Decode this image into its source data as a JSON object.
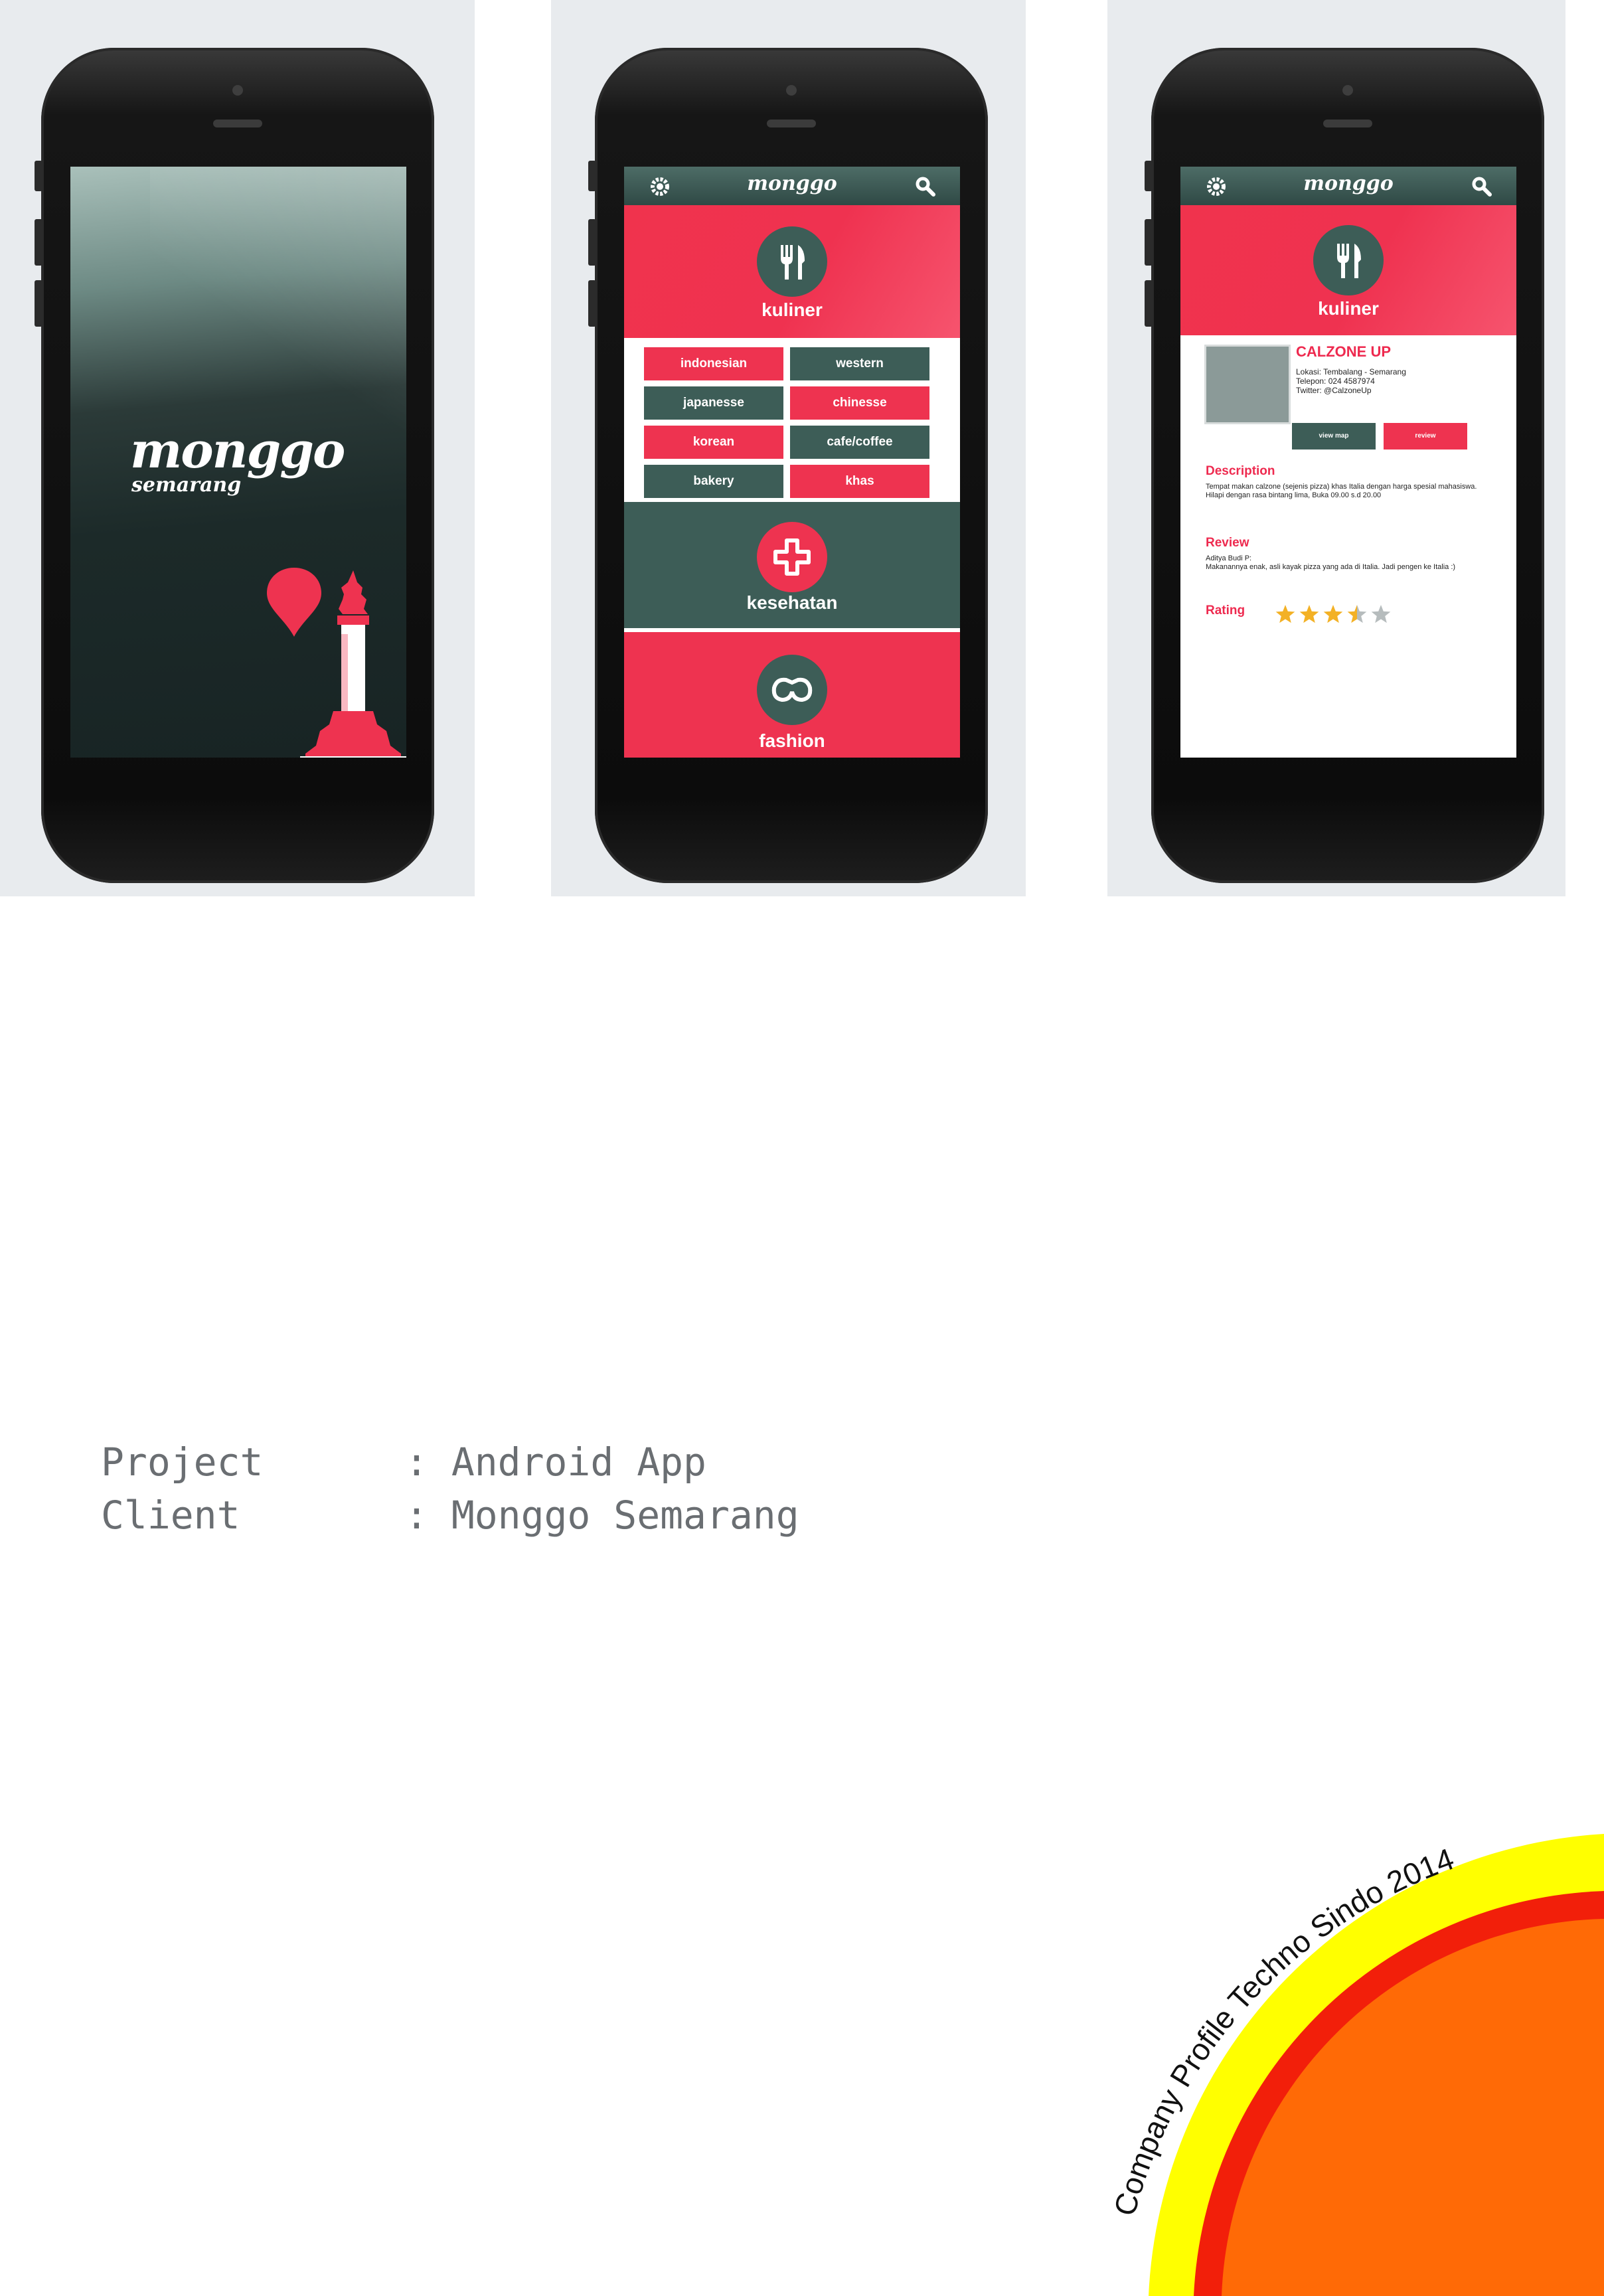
{
  "splash": {
    "logo_title": "monggo",
    "logo_subtitle": "semarang"
  },
  "menu_screen": {
    "header_logo": "monggo",
    "categories": [
      {
        "label": "kuliner",
        "icon": "fork-knife-icon"
      },
      {
        "label": "kesehatan",
        "icon": "medical-cross-icon"
      },
      {
        "label": "fashion",
        "icon": "sunglasses-icon"
      }
    ],
    "subcategories": [
      "indonesian",
      "western",
      "japanesse",
      "chinesse",
      "korean",
      "cafe/coffee",
      "bakery",
      "khas"
    ]
  },
  "detail_screen": {
    "header_logo": "monggo",
    "category": "kuliner",
    "place_name": "CALZONE UP",
    "location": "Lokasi: Tembalang - Semarang",
    "phone": "Telepon: 024 4587974",
    "twitter": "Twitter: @CalzoneUp",
    "view_map_label": "view map",
    "review_label": "review",
    "description_heading": "Description",
    "description_text": "Tempat makan calzone (sejenis pizza) khas Italia dengan harga spesial mahasiswa. Hilapi dengan rasa bintang lima, Buka 09.00 s.d 20.00",
    "review_heading": "Review",
    "review_author": "Aditya Budi P:",
    "review_text": "Makanannya enak, asli kayak pizza yang ada di Italia. Jadi pengen ke Italia :)",
    "rating_heading": "Rating",
    "rating_value": 3.5,
    "rating_max": 5
  },
  "caption": {
    "project_label": "Project",
    "project_value": ": Android App",
    "client_label": "Client",
    "client_value": ": Monggo Semarang"
  },
  "badge": {
    "text": "Company Profile Techno Sindo 2014",
    "colors": {
      "outer": "#ffff00",
      "middle": "#f21f0a",
      "inner": "#ff6a06"
    }
  },
  "colors": {
    "accent_red": "#ee3350",
    "accent_green": "#3d5d57",
    "star_gold": "#f3b125",
    "star_grey": "#b6bcbd"
  }
}
